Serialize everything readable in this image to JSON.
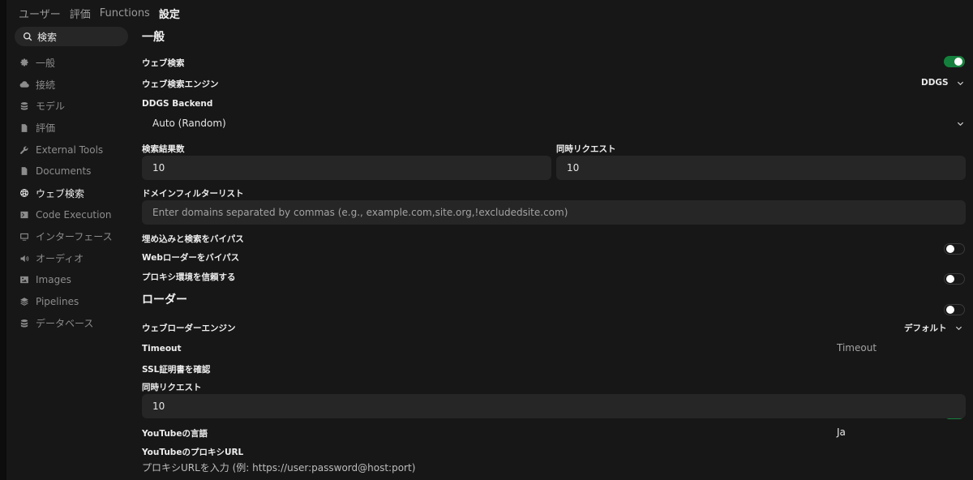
{
  "topnav": {
    "items": [
      "ユーザー",
      "評価",
      "Functions",
      "設定"
    ]
  },
  "sidebar": {
    "search_label": "検索",
    "items": [
      {
        "label": "一般",
        "icon": "gear-icon"
      },
      {
        "label": "接続",
        "icon": "cloud-icon"
      },
      {
        "label": "モデル",
        "icon": "stack-icon"
      },
      {
        "label": "評価",
        "icon": "document-icon"
      },
      {
        "label": "External Tools",
        "icon": "wrench-icon"
      },
      {
        "label": "Documents",
        "icon": "document-icon"
      },
      {
        "label": "ウェブ検索",
        "icon": "globe-icon"
      },
      {
        "label": "Code Execution",
        "icon": "terminal-icon"
      },
      {
        "label": "インターフェース",
        "icon": "monitor-icon"
      },
      {
        "label": "オーディオ",
        "icon": "speaker-icon"
      },
      {
        "label": "Images",
        "icon": "image-icon"
      },
      {
        "label": "Pipelines",
        "icon": "layers-icon"
      },
      {
        "label": "データベース",
        "icon": "database-icon"
      }
    ]
  },
  "general": {
    "title": "一般",
    "web_search_label": "ウェブ検索",
    "web_search_enabled": true,
    "engine_label": "ウェブ検索エンジン",
    "engine_value": "DDGS",
    "backend_label": "DDGS Backend",
    "backend_value": "Auto (Random)",
    "result_count_label": "検索結果数",
    "result_count_value": "10",
    "concurrent_label": "同時リクエスト",
    "concurrent_value": "10",
    "domain_filter_label": "ドメインフィルターリスト",
    "domain_filter_placeholder": "Enter domains separated by commas (e.g., example.com,site.org,!excludedsite.com)",
    "bypass_embed_label": "埋め込みと検索をバイパス",
    "bypass_embed_enabled": false,
    "bypass_loader_label": "Webローダーをバイパス",
    "bypass_loader_enabled": false,
    "trust_proxy_label": "プロキシ環境を信頼する",
    "trust_proxy_enabled": false
  },
  "loader": {
    "title": "ローダー",
    "engine_label": "ウェブローダーエンジン",
    "engine_value": "デフォルト",
    "timeout_label": "Timeout",
    "timeout_placeholder": "Timeout",
    "ssl_label": "SSL証明書を確認",
    "ssl_enabled": true,
    "concurrent_label": "同時リクエスト",
    "concurrent_value": "10",
    "youtube_lang_label": "YouTubeの言語",
    "youtube_lang_value": "Ja",
    "youtube_proxy_label": "YouTubeのプロキシURL",
    "youtube_proxy_placeholder": "プロキシURLを入力 (例: https://user:password@host:port)"
  },
  "colors": {
    "toggle_on": "#15803d",
    "background": "#171717",
    "input_bg": "#262626"
  }
}
